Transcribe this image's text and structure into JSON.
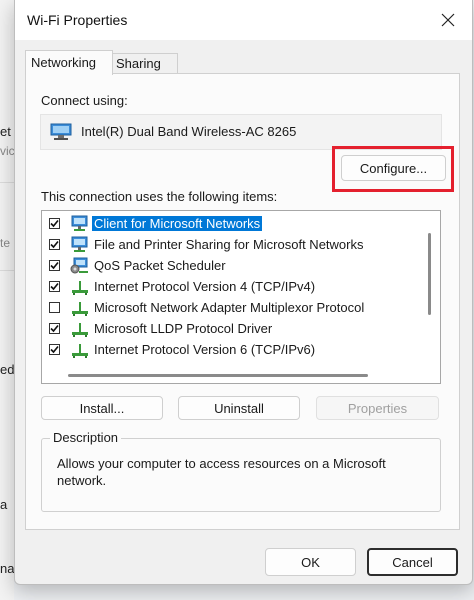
{
  "background": {
    "fragments": [
      "et",
      "vic",
      "te",
      "ed",
      "a",
      "na"
    ]
  },
  "dialog": {
    "title": "Wi-Fi Properties",
    "close_icon": "close-icon",
    "tabs": [
      {
        "label": "Networking",
        "active": true
      },
      {
        "label": "Sharing",
        "active": false
      }
    ],
    "connect_using_label": "Connect using:",
    "adapter": {
      "icon": "network-adapter-icon",
      "name": "Intel(R) Dual Band Wireless-AC 8265"
    },
    "configure_label": "Configure...",
    "items_label": "This connection uses the following items:",
    "items": [
      {
        "label": "Client for Microsoft Networks",
        "checked": true,
        "icon": "network-client-icon",
        "selected": true
      },
      {
        "label": "File and Printer Sharing for Microsoft Networks",
        "checked": true,
        "icon": "network-client-icon",
        "selected": false
      },
      {
        "label": "QoS Packet Scheduler",
        "checked": true,
        "icon": "network-service-icon",
        "selected": false
      },
      {
        "label": "Internet Protocol Version 4 (TCP/IPv4)",
        "checked": true,
        "icon": "protocol-icon",
        "selected": false
      },
      {
        "label": "Microsoft Network Adapter Multiplexor Protocol",
        "checked": false,
        "icon": "protocol-icon",
        "selected": false
      },
      {
        "label": "Microsoft LLDP Protocol Driver",
        "checked": true,
        "icon": "protocol-icon",
        "selected": false
      },
      {
        "label": "Internet Protocol Version 6 (TCP/IPv6)",
        "checked": true,
        "icon": "protocol-icon",
        "selected": false
      }
    ],
    "install_label": "Install...",
    "uninstall_label": "Uninstall",
    "properties_label": "Properties",
    "description_title": "Description",
    "description_text": "Allows your computer to access resources on a Microsoft network.",
    "ok_label": "OK",
    "cancel_label": "Cancel"
  },
  "colors": {
    "selection": "#0078d7",
    "highlight_box": "#e4202e"
  }
}
